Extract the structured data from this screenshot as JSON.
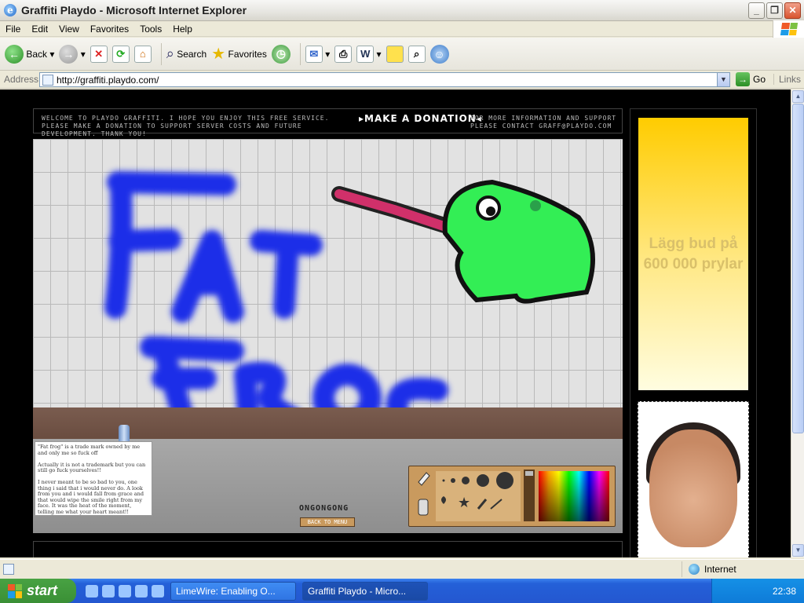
{
  "window": {
    "title": "Graffiti Playdo - Microsoft Internet Explorer"
  },
  "menu": [
    "File",
    "Edit",
    "View",
    "Favorites",
    "Tools",
    "Help"
  ],
  "toolbar": {
    "back": "Back",
    "search": "Search",
    "favorites": "Favorites"
  },
  "address": {
    "label": "Address",
    "url": "http://graffiti.playdo.com/",
    "go": "Go",
    "links": "Links"
  },
  "page": {
    "welcome_left": "WELCOME TO PLAYDO GRAFFITI. I HOPE YOU ENJOY THIS FREE SERVICE. PLEASE MAKE A DONATION TO SUPPORT SERVER COSTS AND FUTURE DEVELOPMENT. THANK YOU!",
    "donation": "MAKE A DONATION",
    "welcome_right": "FOR MORE INFORMATION AND SUPPORT PLEASE CONTACT GRAFF@PLAYDO.COM",
    "note": "\"Fat frog\" is a trade mark owned by me and only me so fuck off\n\nActually it is not a trademark but you can still go fuck yourselves!!\n\nI never meant to be so bad to you, one thing i said that i would never do. A look from you and i would fall from grace and that would wipe the smile right from my face. It was the heat of the moment, telling me what your heart meant!!",
    "artist": "ONGONGONG",
    "back_menu": "BACK TO MENU"
  },
  "ad": {
    "text": "Lägg bud på 600 000 prylar"
  },
  "status": {
    "zone": "Internet"
  },
  "taskbar": {
    "start": "start",
    "tasks": [
      "LimeWire: Enabling O...",
      "Graffiti Playdo - Micro..."
    ],
    "clock": "22:38"
  },
  "colors": {
    "graffiti_blue": "#1b2fe8",
    "frog_green": "#33ee55",
    "tongue": "#d0306a",
    "ad_yellow": "#ffcc00"
  }
}
